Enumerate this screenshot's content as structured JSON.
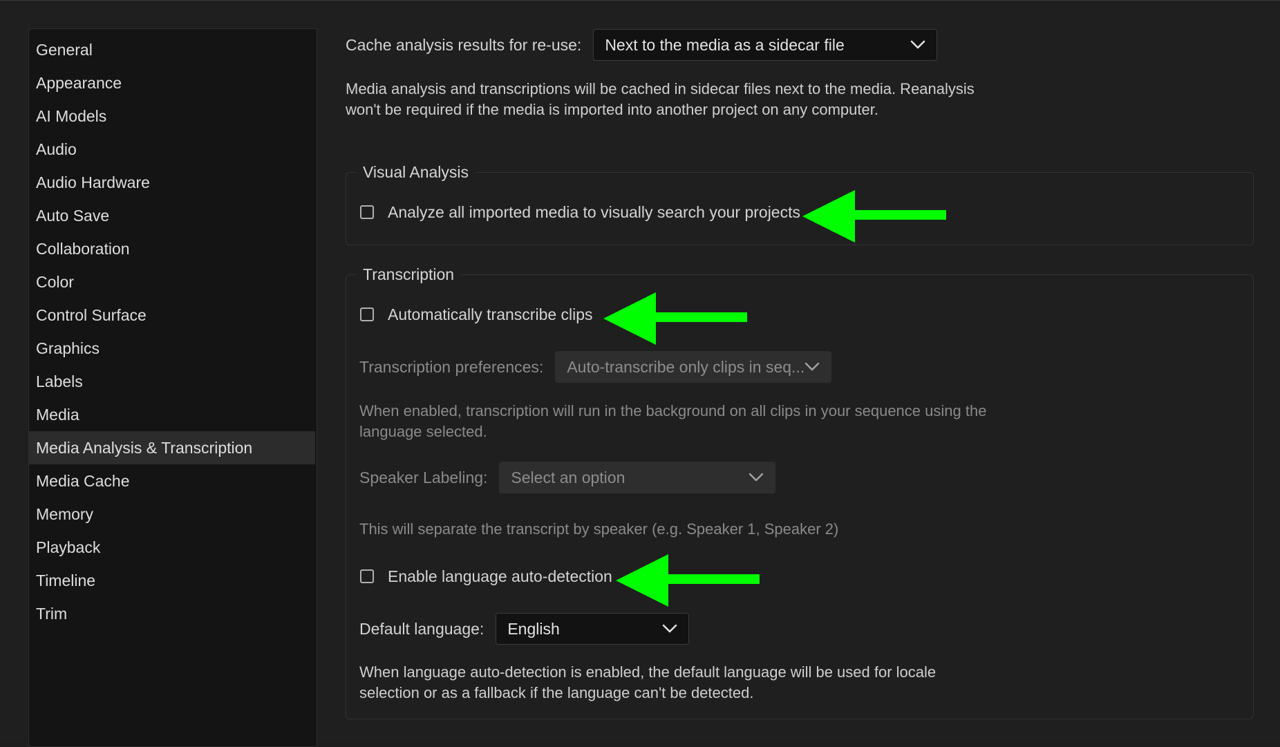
{
  "sidebar": {
    "items": [
      {
        "label": "General"
      },
      {
        "label": "Appearance"
      },
      {
        "label": "AI Models"
      },
      {
        "label": "Audio"
      },
      {
        "label": "Audio Hardware"
      },
      {
        "label": "Auto Save"
      },
      {
        "label": "Collaboration"
      },
      {
        "label": "Color"
      },
      {
        "label": "Control Surface"
      },
      {
        "label": "Graphics"
      },
      {
        "label": "Labels"
      },
      {
        "label": "Media"
      },
      {
        "label": "Media Analysis & Transcription"
      },
      {
        "label": "Media Cache"
      },
      {
        "label": "Memory"
      },
      {
        "label": "Playback"
      },
      {
        "label": "Timeline"
      },
      {
        "label": "Trim"
      }
    ],
    "selected": "Media Analysis & Transcription"
  },
  "cache": {
    "label": "Cache analysis results for re-use:",
    "value": "Next to the media as a sidecar file",
    "description": "Media analysis and transcriptions will be cached in sidecar files next to the media. Reanalysis won't be required if the media is imported into another project on any computer."
  },
  "visual_analysis": {
    "title": "Visual Analysis",
    "checkbox_label": "Analyze all imported media to visually search your projects",
    "checked": false
  },
  "transcription": {
    "title": "Transcription",
    "auto_transcribe_label": "Automatically transcribe clips",
    "auto_transcribe_checked": false,
    "preferences_label": "Transcription preferences:",
    "preferences_value": "Auto-transcribe only clips in seq...",
    "preferences_description": "When enabled, transcription will run in the background on all clips in your sequence using the language selected.",
    "speaker_label": "Speaker Labeling:",
    "speaker_value": "Select an option",
    "speaker_description": "This will separate the transcript by speaker (e.g. Speaker 1, Speaker 2)",
    "language_detect_label": "Enable language auto-detection",
    "language_detect_checked": false,
    "default_language_label": "Default language:",
    "default_language_value": "English",
    "language_description": "When language auto-detection is enabled, the default language will be used for locale selection or as a fallback if the language can't be detected."
  },
  "annotations": {
    "arrow_color": "#00ff00"
  },
  "colors": {
    "background": "#1f1f1f",
    "sidebar": "#141414",
    "selected_item": "#2c2c2c"
  }
}
